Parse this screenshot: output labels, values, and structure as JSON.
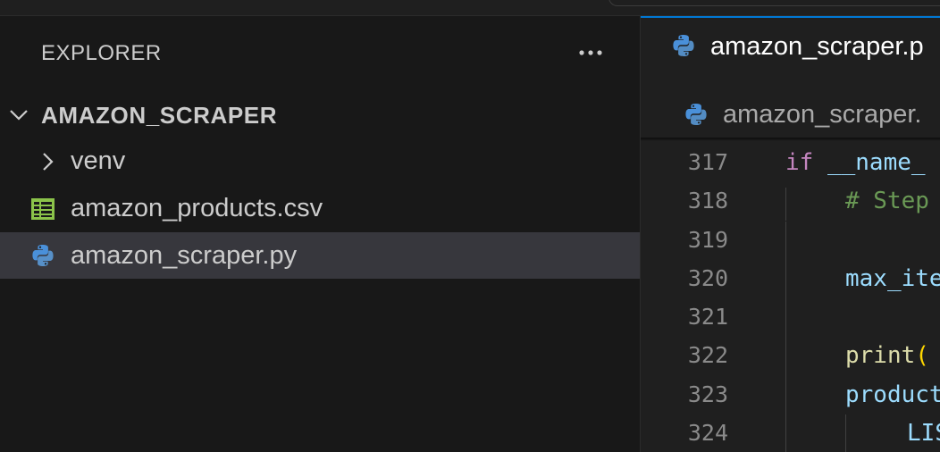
{
  "sidebar": {
    "title": "EXPLORER",
    "more_label": "···",
    "root": {
      "label": "AMAZON_SCRAPER",
      "expanded": true
    },
    "items": [
      {
        "label": "venv",
        "type": "folder",
        "expanded": false,
        "icon": "chevron-right-icon"
      },
      {
        "label": "amazon_products.csv",
        "type": "file",
        "icon": "csv-file-icon"
      },
      {
        "label": "amazon_scraper.py",
        "type": "file",
        "icon": "python-file-icon",
        "selected": true
      }
    ]
  },
  "editor": {
    "tab": {
      "label": "amazon_scraper.p",
      "icon": "python-file-icon",
      "active": true
    },
    "breadcrumb": {
      "label": "amazon_scraper.",
      "icon": "python-file-icon"
    },
    "lines": [
      {
        "num": "317",
        "tokens": [
          {
            "t": "if",
            "c": "kw"
          },
          {
            "t": " ",
            "c": ""
          },
          {
            "t": "__name_",
            "c": "var"
          }
        ],
        "indent": 0
      },
      {
        "num": "318",
        "tokens": [
          {
            "t": "# Step",
            "c": "cm"
          }
        ],
        "indent": 1
      },
      {
        "num": "319",
        "tokens": [],
        "indent": 1
      },
      {
        "num": "320",
        "tokens": [
          {
            "t": "max_ite",
            "c": "var"
          }
        ],
        "indent": 1
      },
      {
        "num": "321",
        "tokens": [],
        "indent": 1
      },
      {
        "num": "322",
        "tokens": [
          {
            "t": "print",
            "c": "fn"
          },
          {
            "t": "(",
            "c": "br"
          }
        ],
        "indent": 1
      },
      {
        "num": "323",
        "tokens": [
          {
            "t": "product",
            "c": "var"
          }
        ],
        "indent": 1
      },
      {
        "num": "324",
        "tokens": [
          {
            "t": "LIS",
            "c": "var"
          }
        ],
        "indent": 2
      }
    ]
  },
  "colors": {
    "background": "#181818",
    "selected_row": "#37373d",
    "active_tab_border": "#0078d4",
    "csv_icon": "#8bc34a",
    "python_blue": "#3b7bbf",
    "python_yellow": "#ffd43b"
  }
}
